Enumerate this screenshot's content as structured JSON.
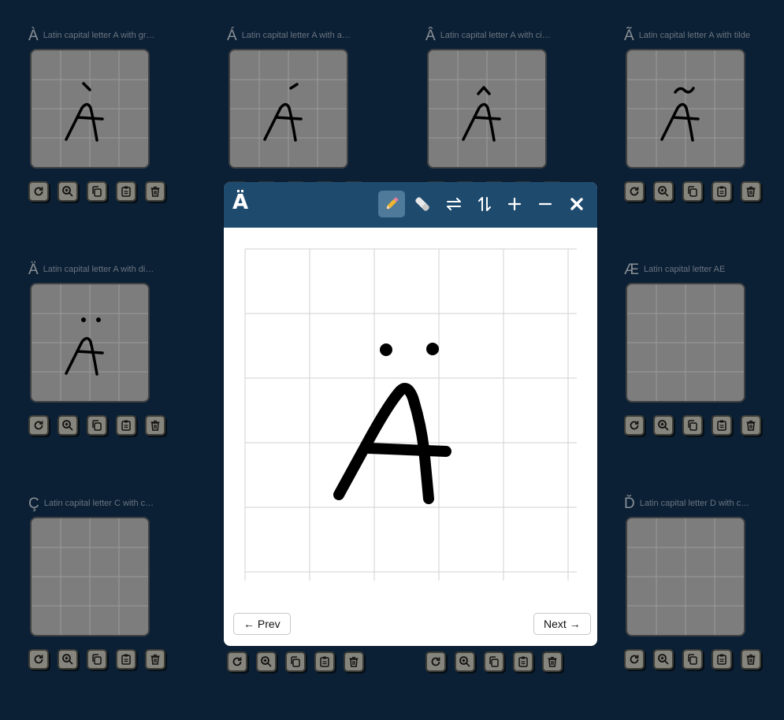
{
  "cards": [
    {
      "glyph": "À",
      "name": "Latin capital letter A with gr…"
    },
    {
      "glyph": "Á",
      "name": "Latin capital letter A with a…"
    },
    {
      "glyph": "Â",
      "name": "Latin capital letter A with ci…"
    },
    {
      "glyph": "Ã",
      "name": "Latin capital letter A with tilde"
    },
    {
      "glyph": "Ä",
      "name": "Latin capital letter A with di…"
    },
    {
      "glyph": "Æ",
      "name": "Latin capital letter AE"
    },
    {
      "glyph": "Ç",
      "name": "Latin capital letter C with c…"
    },
    {
      "glyph": "Ď",
      "name": "Latin capital letter D with c…"
    }
  ],
  "card_tools": [
    "undo-icon",
    "zoom-in-icon",
    "copy-icon",
    "paste-icon",
    "trash-icon"
  ],
  "modal": {
    "glyph": "Ä",
    "tools": [
      "pencil-icon",
      "eraser-icon",
      "flip-horizontal-icon",
      "flip-vertical-icon",
      "plus-icon",
      "minus-icon",
      "close-icon"
    ],
    "active_tool": "pencil-icon",
    "prev_label": "← Prev",
    "next_label": "Next →"
  },
  "colors": {
    "background": "#0b2035",
    "modal_header": "#1e4a6e",
    "card_canvas": "#7d7d7d"
  }
}
